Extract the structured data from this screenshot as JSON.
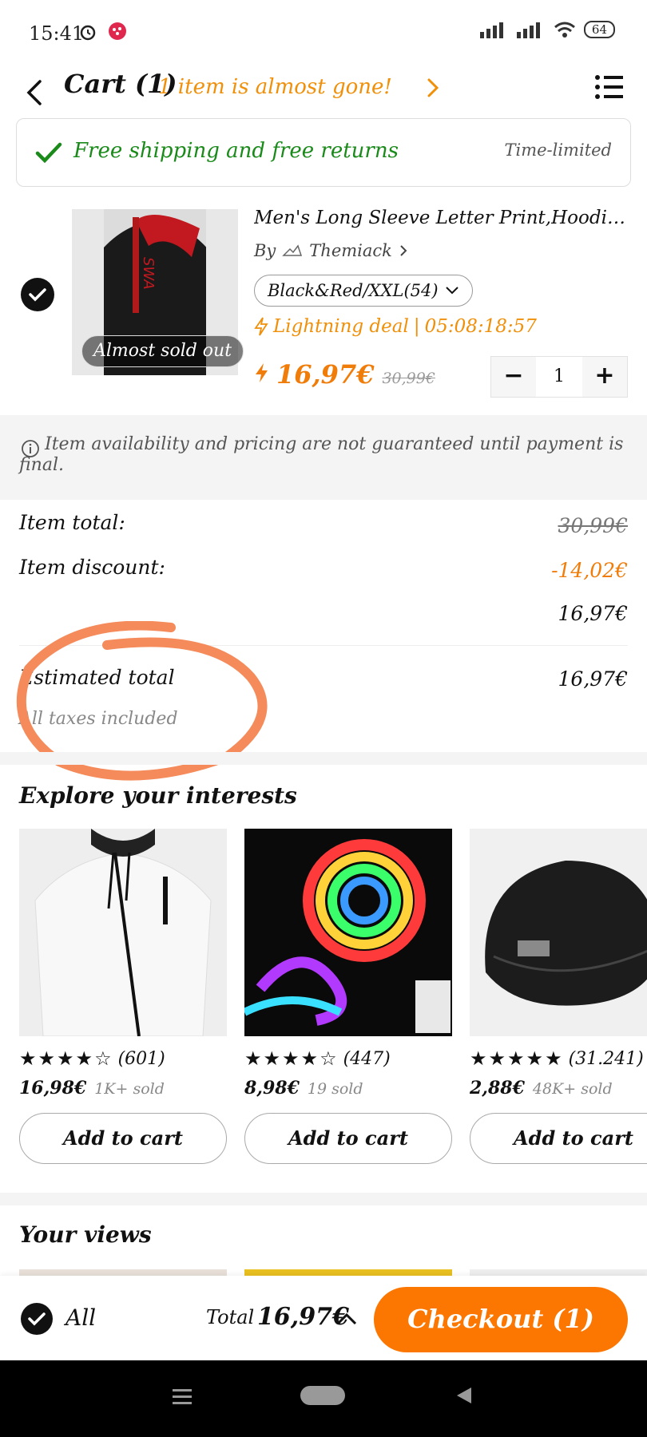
{
  "status_bar": {
    "time": "15:41",
    "battery": "64"
  },
  "header": {
    "title": "Cart (1)",
    "alert": "1 item is almost gone!"
  },
  "shipping": {
    "text": "Free shipping and free returns",
    "tag": "Time-limited"
  },
  "product": {
    "name": "Men's Long Sleeve Letter Print,Hoodies Stre...",
    "by": "By",
    "store": "Themiack",
    "variant": "Black&Red/XXL(54)",
    "deal_label": "Lightning deal",
    "deal_timer": "05:08:18:57",
    "badge": "Almost sold out",
    "price": "16,97€",
    "old_price": "30,99€",
    "quantity": "1"
  },
  "note": "Item availability and pricing are not guaranteed until payment is final.",
  "summary": {
    "item_total_label": "Item total:",
    "item_total_value": "30,99€",
    "discount_label": "Item discount:",
    "discount_value": "-14,02€",
    "subtotal_value": "16,97€",
    "estimated_label": "Estimated total",
    "estimated_value": "16,97€",
    "taxes_note": "All taxes included"
  },
  "explore": {
    "title": "Explore your interests",
    "cards": [
      {
        "reviews": "(601)",
        "price": "16,98€",
        "sold": "1K+ sold",
        "button": "Add to cart"
      },
      {
        "reviews": "(447)",
        "price": "8,98€",
        "sold": "19 sold",
        "button": "Add to cart"
      },
      {
        "reviews": "(31.241)",
        "price": "2,88€",
        "sold": "48K+ sold",
        "button": "Add to cart"
      }
    ]
  },
  "views": {
    "title": "Your views"
  },
  "bottom": {
    "all_label": "All",
    "total_label": "Total",
    "total_value": "16,97€",
    "checkout": "Checkout (1)"
  },
  "colors": {
    "accent": "#fb7701",
    "deal": "#f0900a",
    "success": "#1a8a1a"
  }
}
